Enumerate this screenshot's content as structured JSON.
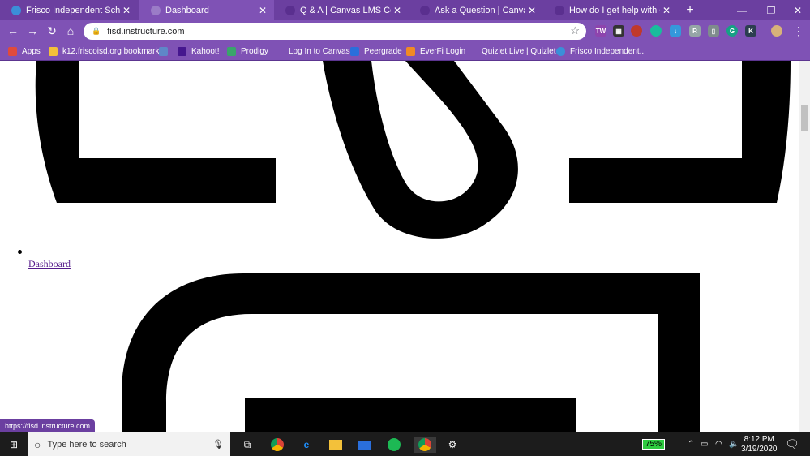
{
  "tabs": [
    {
      "title": "Frisco Independent School Dis",
      "favicon_color": "#3b8fd8",
      "active": false
    },
    {
      "title": "Dashboard",
      "favicon_color": "#7f52b5",
      "active": true
    },
    {
      "title": "Q & A | Canvas LMS Communi",
      "favicon_color": "#6b3fa0",
      "active": false
    },
    {
      "title": "Ask a Question | Canvas LMS C",
      "favicon_color": "#6b3fa0",
      "active": false
    },
    {
      "title": "How do I get help with Canvas",
      "favicon_color": "#6b3fa0",
      "active": false
    }
  ],
  "new_tab_icon": "+",
  "address": {
    "url": "fisd.instructure.com"
  },
  "bookmarks": [
    {
      "label": "Apps",
      "color": "#e04b3c"
    },
    {
      "label": "k12.friscoisd.org bookmarks",
      "color": "#f3c13a"
    },
    {
      "label": "",
      "color": "#5f87c8"
    },
    {
      "label": "Kahoot!",
      "color": "#46178f"
    },
    {
      "label": "Prodigy",
      "color": "#3aa56b"
    },
    {
      "label": "Log In to Canvas",
      "color": "#7f52b5"
    },
    {
      "label": "Peergrade",
      "color": "#2a6fdb"
    },
    {
      "label": "EverFi Login",
      "color": "#f08a24"
    },
    {
      "label": "Quizlet Live | Quizlet",
      "color": "#7f52b5"
    },
    {
      "label": "Frisco Independent...",
      "color": "#3b8fd8"
    }
  ],
  "page": {
    "dashboard_link": "Dashboard"
  },
  "status_url": "https://fisd.instructure.com",
  "taskbar": {
    "search_placeholder": "Type here to search",
    "battery": "75%",
    "time": "8:12 PM",
    "date": "3/19/2020"
  }
}
